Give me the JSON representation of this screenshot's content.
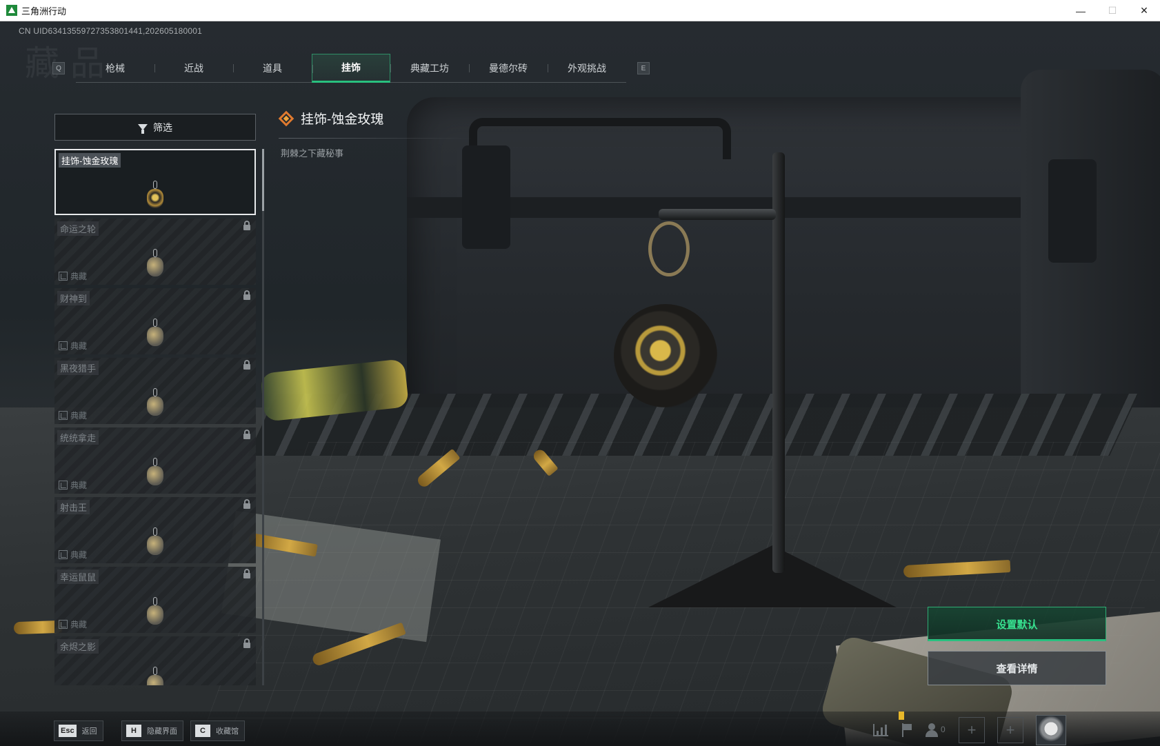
{
  "window": {
    "title": "三角洲行动",
    "controls": {
      "minimize": "—",
      "maximize": "☐",
      "close": "✕"
    }
  },
  "uid": "CN UID634135597273538014­41,202605180001",
  "header": {
    "prev_key": "Q",
    "next_key": "E",
    "tabs": [
      "枪械",
      "近战",
      "道具",
      "挂饰",
      "典藏工坊",
      "曼德尔砖",
      "外观挑战"
    ],
    "active_tab_index": 3
  },
  "filter": {
    "label": "筛选"
  },
  "items": [
    {
      "name": "挂饰-蚀金玫瑰",
      "selected": true,
      "locked": false,
      "collection": ""
    },
    {
      "name": "命运之轮",
      "selected": false,
      "locked": true,
      "collection": "典藏"
    },
    {
      "name": "财神到",
      "selected": false,
      "locked": true,
      "collection": "典藏"
    },
    {
      "name": "黑夜猎手",
      "selected": false,
      "locked": true,
      "collection": "典藏"
    },
    {
      "name": "统统拿走",
      "selected": false,
      "locked": true,
      "collection": "典藏"
    },
    {
      "name": "射击王",
      "selected": false,
      "locked": true,
      "collection": "典藏"
    },
    {
      "name": "幸运鼠鼠",
      "selected": false,
      "locked": true,
      "collection": "典藏"
    },
    {
      "name": "余烬之影",
      "selected": false,
      "locked": true,
      "collection": ""
    }
  ],
  "detail": {
    "title": "挂饰-蚀金玫瑰",
    "subtitle": "荆棘之下藏秘事",
    "icon": "diamond-rarity-icon",
    "rarity_color": "#e07a2f"
  },
  "actions": {
    "set_default": "设置默认",
    "view_details": "查看详情"
  },
  "bottom_hints": [
    {
      "key": "Esc",
      "label": "返回"
    },
    {
      "key": "H",
      "label": "隐藏界面"
    },
    {
      "key": "C",
      "label": "收藏馆"
    }
  ],
  "status": {
    "friends_count": "0",
    "plus_1": "+",
    "plus_2": "+"
  },
  "colors": {
    "accent_green": "#29c07f",
    "accent_green_text": "#37e08f",
    "rarity_orange": "#e07a2f"
  }
}
